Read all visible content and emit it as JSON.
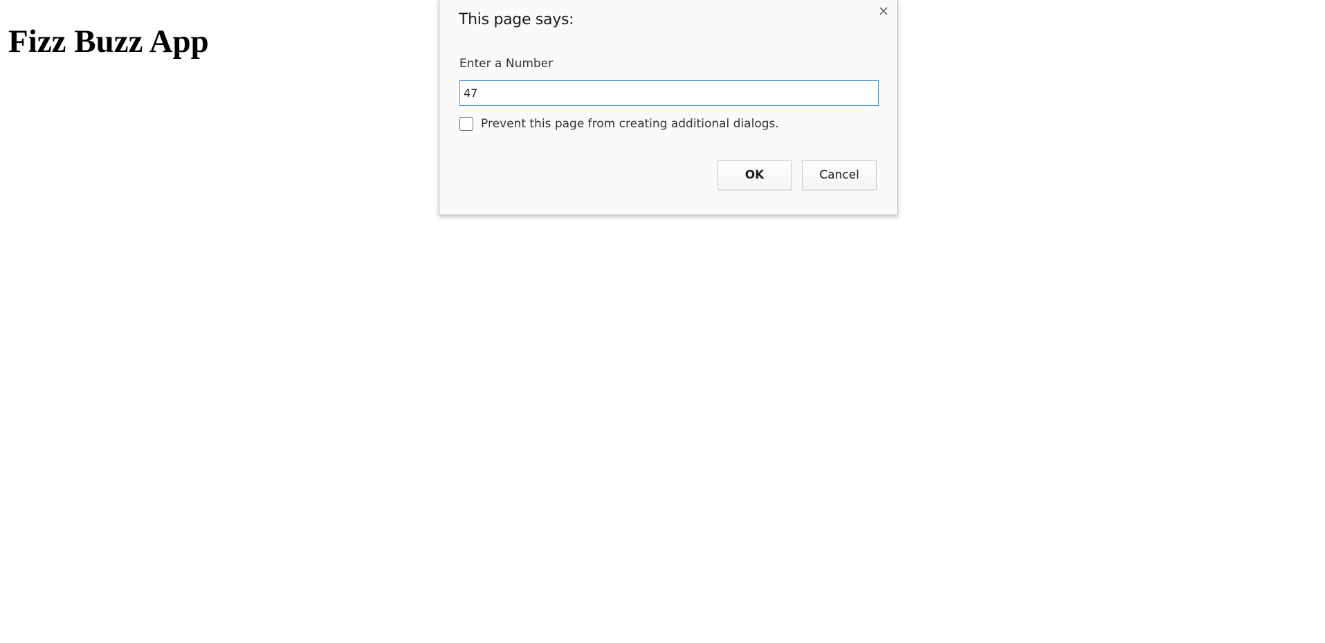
{
  "page": {
    "heading": "Fizz Buzz App"
  },
  "dialog": {
    "title": "This page says:",
    "prompt": "Enter a Number",
    "input_value": "47",
    "suppress_label": "Prevent this page from creating additional dialogs.",
    "suppress_checked": false,
    "ok_label": "OK",
    "cancel_label": "Cancel",
    "close_icon": "close-icon"
  },
  "colors": {
    "input_focus_border": "#4a90d9",
    "dialog_background": "#fafafa"
  }
}
